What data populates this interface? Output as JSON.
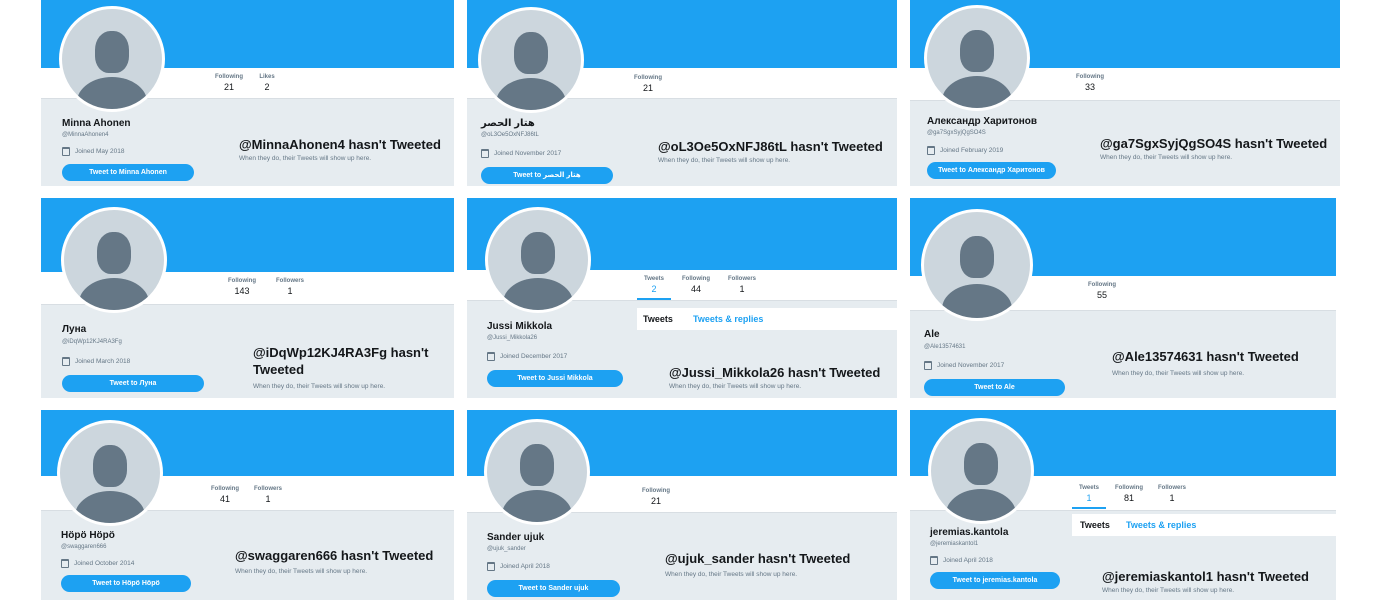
{
  "profiles": [
    {
      "name": "Minna Ahonen",
      "handle": "@MinnaAhonen4",
      "joined": "Joined May 2018",
      "tweet_button": "Tweet to Minna Ahonen",
      "empty_handle": "@MinnaAhonen4",
      "empty_suffix": "hasn't Tweeted",
      "empty_sub": "When they do, their Tweets will show up here.",
      "stats": [
        {
          "label": "Following",
          "value": "21"
        },
        {
          "label": "Likes",
          "value": "2"
        }
      ]
    },
    {
      "name": "هتار الحصر",
      "handle": "@oL3Oe5OxNFJ86tL",
      "joined": "Joined November 2017",
      "tweet_button": "Tweet to هتار الحصر",
      "empty_handle": "@oL3Oe5OxNFJ86tL",
      "empty_suffix": "hasn't Tweeted",
      "empty_sub": "When they do, their Tweets will show up here.",
      "stats": [
        {
          "label": "Following",
          "value": "21"
        }
      ]
    },
    {
      "name": "Александр Харитонов",
      "handle": "@ga7SgxSyjQgSO4S",
      "joined": "Joined February 2019",
      "tweet_button": "Tweet to Александр Харитонов",
      "empty_handle": "@ga7SgxSyjQgSO4S",
      "empty_suffix": "hasn't Tweeted",
      "empty_sub": "When they do, their Tweets will show up here.",
      "stats": [
        {
          "label": "Following",
          "value": "33"
        }
      ]
    },
    {
      "name": "Луна",
      "handle": "@iDqWp12KJ4RA3Fg",
      "joined": "Joined March 2018",
      "tweet_button": "Tweet to Луна",
      "empty_handle": "@iDqWp12KJ4RA3Fg",
      "empty_suffix": "hasn't Tweeted",
      "empty_sub": "When they do, their Tweets will show up here.",
      "stats": [
        {
          "label": "Following",
          "value": "143"
        },
        {
          "label": "Followers",
          "value": "1"
        }
      ]
    },
    {
      "name": "Jussi Mikkola",
      "handle": "@Jussi_Mikkola26",
      "joined": "Joined December 2017",
      "tweet_button": "Tweet to Jussi Mikkola",
      "empty_handle": "@Jussi_Mikkola26",
      "empty_suffix": "hasn't Tweeted",
      "empty_sub": "When they do, their Tweets will show up here.",
      "stats": [
        {
          "label": "Tweets",
          "value": "2"
        },
        {
          "label": "Following",
          "value": "44"
        },
        {
          "label": "Followers",
          "value": "1"
        }
      ],
      "tabs": [
        "Tweets",
        "Tweets & replies"
      ]
    },
    {
      "name": "Ale",
      "handle": "@Ale13574631",
      "joined": "Joined November 2017",
      "tweet_button": "Tweet to Ale",
      "empty_handle": "@Ale13574631",
      "empty_suffix": "hasn't Tweeted",
      "empty_sub": "When they do, their Tweets will show up here.",
      "stats": [
        {
          "label": "Following",
          "value": "55"
        }
      ]
    },
    {
      "name": "Höpö Höpö",
      "handle": "@swaggaren666",
      "joined": "Joined October 2014",
      "tweet_button": "Tweet to Höpö Höpö",
      "empty_handle": "@swaggaren666",
      "empty_suffix": "hasn't Tweeted",
      "empty_sub": "When they do, their Tweets will show up here.",
      "stats": [
        {
          "label": "Following",
          "value": "41"
        },
        {
          "label": "Followers",
          "value": "1"
        }
      ]
    },
    {
      "name": "Sander ujuk",
      "handle": "@ujuk_sander",
      "joined": "Joined April 2018",
      "tweet_button": "Tweet to Sander ujuk",
      "empty_handle": "@ujuk_sander",
      "empty_suffix": "hasn't Tweeted",
      "empty_sub": "When they do, their Tweets will show up here.",
      "stats": [
        {
          "label": "Following",
          "value": "21"
        }
      ]
    },
    {
      "name": "jeremias.kantola",
      "handle": "@jeremiaskantol1",
      "joined": "Joined April 2018",
      "tweet_button": "Tweet to jeremias.kantola",
      "empty_handle": "@jeremiaskantol1",
      "empty_suffix": "hasn't Tweeted",
      "empty_sub": "When they do, their Tweets will show up here.",
      "stats": [
        {
          "label": "Tweets",
          "value": "1"
        },
        {
          "label": "Following",
          "value": "81"
        },
        {
          "label": "Followers",
          "value": "1"
        }
      ],
      "tabs": [
        "Tweets",
        "Tweets & replies"
      ]
    }
  ],
  "colors": {
    "brand_blue": "#1da1f2",
    "panel_bg": "#e6ecf0",
    "avatar_bg": "#ccd6dd",
    "avatar_fg": "#657786"
  }
}
